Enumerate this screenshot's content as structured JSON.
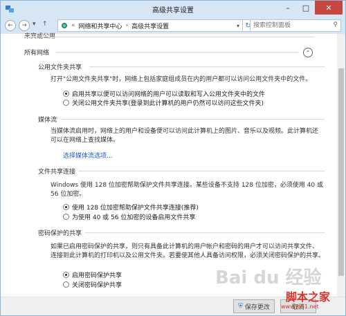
{
  "window": {
    "title": "高级共享设置"
  },
  "nav": {
    "back": "←",
    "forward": "→",
    "dropdown": "▾",
    "up": "↑",
    "breadcrumb": [
      "网络和共享中心",
      "高级共享设置"
    ],
    "search_placeholder": "搜索控制面板"
  },
  "content": {
    "cutoff_section": "来宾或公用",
    "profile_label": "所有网络",
    "sections": [
      {
        "title": "公用文件夹共享",
        "description": "打开\"公用文件夹共享\"时，网络上包括家庭组成员在内的用户都可以访问公用文件夹中的文件。",
        "options": [
          "启用共享以便可以访问网络的用户可以读取和写入公用文件夹中的文件",
          "关闭公用文件夹共享(登录到此计算机的用户仍然可以访问这些文件夹)"
        ],
        "selected": 0
      },
      {
        "title": "媒体流",
        "description_lines": [
          "当媒体流启用时，网络上的用户和设备便可以访问此计算机上的图片、音乐以及视频。此计算机还",
          "可以在网络上查找媒体。"
        ],
        "link": "选择媒体流选项..."
      },
      {
        "title": "文件共享连接",
        "description_lines": [
          "Windows 使用 128 位加密帮助保护文件共享连接。某些设备不支持 128 位加密，必须使用 40 或",
          "56 位加密。"
        ],
        "options": [
          "使用 128 位加密帮助保护文件共享连接(推荐)",
          "为使用 40 或 56 位加密的设备启用文件共享"
        ],
        "selected": 0
      },
      {
        "title": "密码保护的共享",
        "description_lines": [
          "如果已启用密码保护的共享，则只有具备此计算机的用户帐户和密码的用户才可以访问共享文件、",
          "连接到此计算机的打印机以及公用文件夹。若要使其他人具备访问权限，必须关闭密码保护的共享。"
        ],
        "options": [
          "启用密码保护共享",
          "关闭密码保护共享"
        ],
        "selected": 0
      }
    ]
  },
  "footer": {
    "save": "保存更改",
    "cancel": "取消"
  },
  "watermark": {
    "baidu": "Bai du 经验",
    "site": "脚本之家",
    "url": "www.jb51.net"
  }
}
